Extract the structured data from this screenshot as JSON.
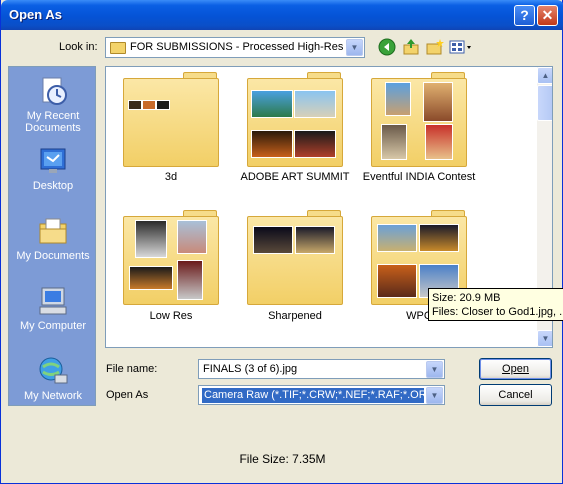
{
  "window": {
    "title": "Open As",
    "help_label": "?",
    "close_label": "✕"
  },
  "lookin": {
    "label": "Look in:",
    "value": "FOR SUBMISSIONS - Processed High-Res",
    "icons": [
      "back-icon",
      "up-folder-icon",
      "new-folder-icon",
      "views-menu-icon"
    ]
  },
  "places": [
    {
      "label": "My Recent Documents",
      "icon": "recent-documents-icon"
    },
    {
      "label": "Desktop",
      "icon": "desktop-icon"
    },
    {
      "label": "My Documents",
      "icon": "my-documents-icon"
    },
    {
      "label": "My Computer",
      "icon": "my-computer-icon"
    },
    {
      "label": "My Network",
      "icon": "my-network-icon"
    }
  ],
  "folders": [
    {
      "name": "3d"
    },
    {
      "name": "ADOBE ART SUMMIT"
    },
    {
      "name": "Eventful INDIA Contest"
    },
    {
      "name": "Low Res"
    },
    {
      "name": "Sharpened"
    },
    {
      "name": "WPC"
    }
  ],
  "tooltip": {
    "size": "Size: 20.9 MB",
    "files": "Files: Closer to God1.jpg, ..."
  },
  "form": {
    "filename_label": "File name:",
    "filename_value": "FINALS (3 of 6).jpg",
    "openas_label": "Open As",
    "openas_value": "Camera Raw (*.TIF;*.CRW;*.NEF;*.RAF;*.ORF"
  },
  "buttons": {
    "open": "Open",
    "cancel": "Cancel"
  },
  "footer": {
    "file_size": "File Size: 7.35M"
  },
  "colors": {
    "title_bar": "#0553d6",
    "places_bar": "#7d9bd6",
    "selection": "#316ac5",
    "folder": "#f2cf66"
  }
}
